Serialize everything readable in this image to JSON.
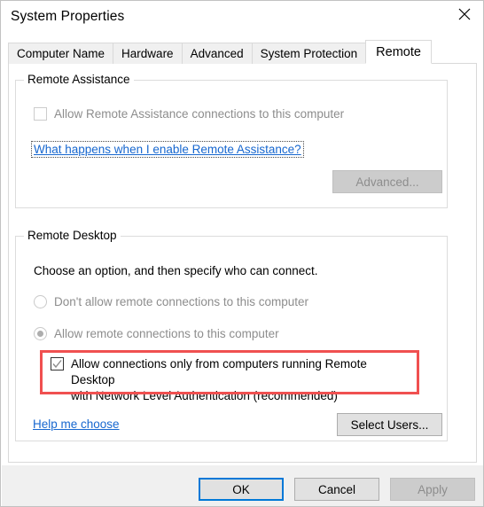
{
  "window": {
    "title": "System Properties",
    "close_icon": "close-icon"
  },
  "tabs": [
    {
      "label": "Computer Name",
      "active": false
    },
    {
      "label": "Hardware",
      "active": false
    },
    {
      "label": "Advanced",
      "active": false
    },
    {
      "label": "System Protection",
      "active": false
    },
    {
      "label": "Remote",
      "active": true
    }
  ],
  "remote_assistance": {
    "legend": "Remote Assistance",
    "allow_checkbox": {
      "label": "Allow Remote Assistance connections to this computer",
      "checked": false,
      "disabled": true
    },
    "help_link": "What happens when I enable Remote Assistance?",
    "advanced_button": {
      "label": "Advanced...",
      "disabled": true
    }
  },
  "remote_desktop": {
    "legend": "Remote Desktop",
    "instruction": "Choose an option, and then specify who can connect.",
    "options": [
      {
        "label": "Don't allow remote connections to this computer",
        "selected": false,
        "disabled": true
      },
      {
        "label": "Allow remote connections to this computer",
        "selected": true,
        "disabled": true
      }
    ],
    "nla_checkbox": {
      "line1": "Allow connections only from computers running Remote Desktop",
      "line2": "with Network Level Authentication (recommended)",
      "checked": true,
      "disabled": true
    },
    "help_link": "Help me choose",
    "select_users_button": {
      "label": "Select Users...",
      "disabled": false
    }
  },
  "footer": {
    "ok_button": "OK",
    "cancel_button": "Cancel",
    "apply_button": "Apply",
    "apply_disabled": true
  },
  "colors": {
    "accent_focus": "#0078d7",
    "link": "#1767cf",
    "annotation": "#f05050",
    "disabled_text": "#8d8d8d"
  }
}
